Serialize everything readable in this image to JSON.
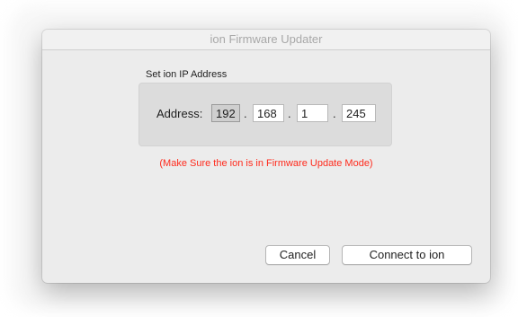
{
  "window": {
    "title": "ion Firmware Updater"
  },
  "ip_section": {
    "label": "Set ion IP Address",
    "address_label": "Address:",
    "octets": [
      "192",
      "168",
      "1",
      "245"
    ],
    "separator": "."
  },
  "warning": {
    "text": "(Make Sure the ion is in Firmware Update Mode)",
    "color": "#ff2a1c"
  },
  "buttons": {
    "cancel": "Cancel",
    "connect": "Connect to ion"
  }
}
